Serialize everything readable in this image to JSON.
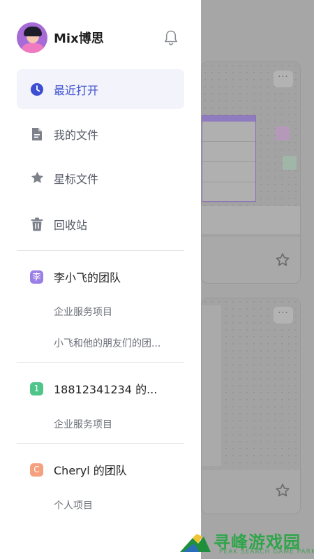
{
  "profile": {
    "name": "Mix博思",
    "avatar_icon": "avatar-image",
    "bell_icon": "bell-icon"
  },
  "nav": [
    {
      "label": "最近打开",
      "icon": "clock-icon",
      "active": true
    },
    {
      "label": "我的文件",
      "icon": "file-icon",
      "active": false
    },
    {
      "label": "星标文件",
      "icon": "star-icon",
      "active": false
    },
    {
      "label": "回收站",
      "icon": "trash-icon",
      "active": false
    }
  ],
  "teams": [
    {
      "badge": "李",
      "badge_color": "#9b7fe6",
      "name": "李小飞的团队",
      "projects": [
        "企业服务项目",
        "小飞和他的朋友们的团..."
      ]
    },
    {
      "badge": "1",
      "badge_color": "#4fc58a",
      "name": "18812341234 的...",
      "projects": [
        "企业服务项目"
      ]
    },
    {
      "badge": "C",
      "badge_color": "#f5a07e",
      "name": "Cheryl 的团队",
      "projects": [
        "个人项目"
      ]
    }
  ],
  "background": {
    "more_label": "···"
  },
  "watermark": {
    "title": "寻峰游戏园",
    "subtitle": "PEAK SEARCH GAME PARK"
  },
  "colors": {
    "accent": "#3d4fd1",
    "active_bg": "#f3f4fb",
    "overlay": "#9e9e9e"
  }
}
